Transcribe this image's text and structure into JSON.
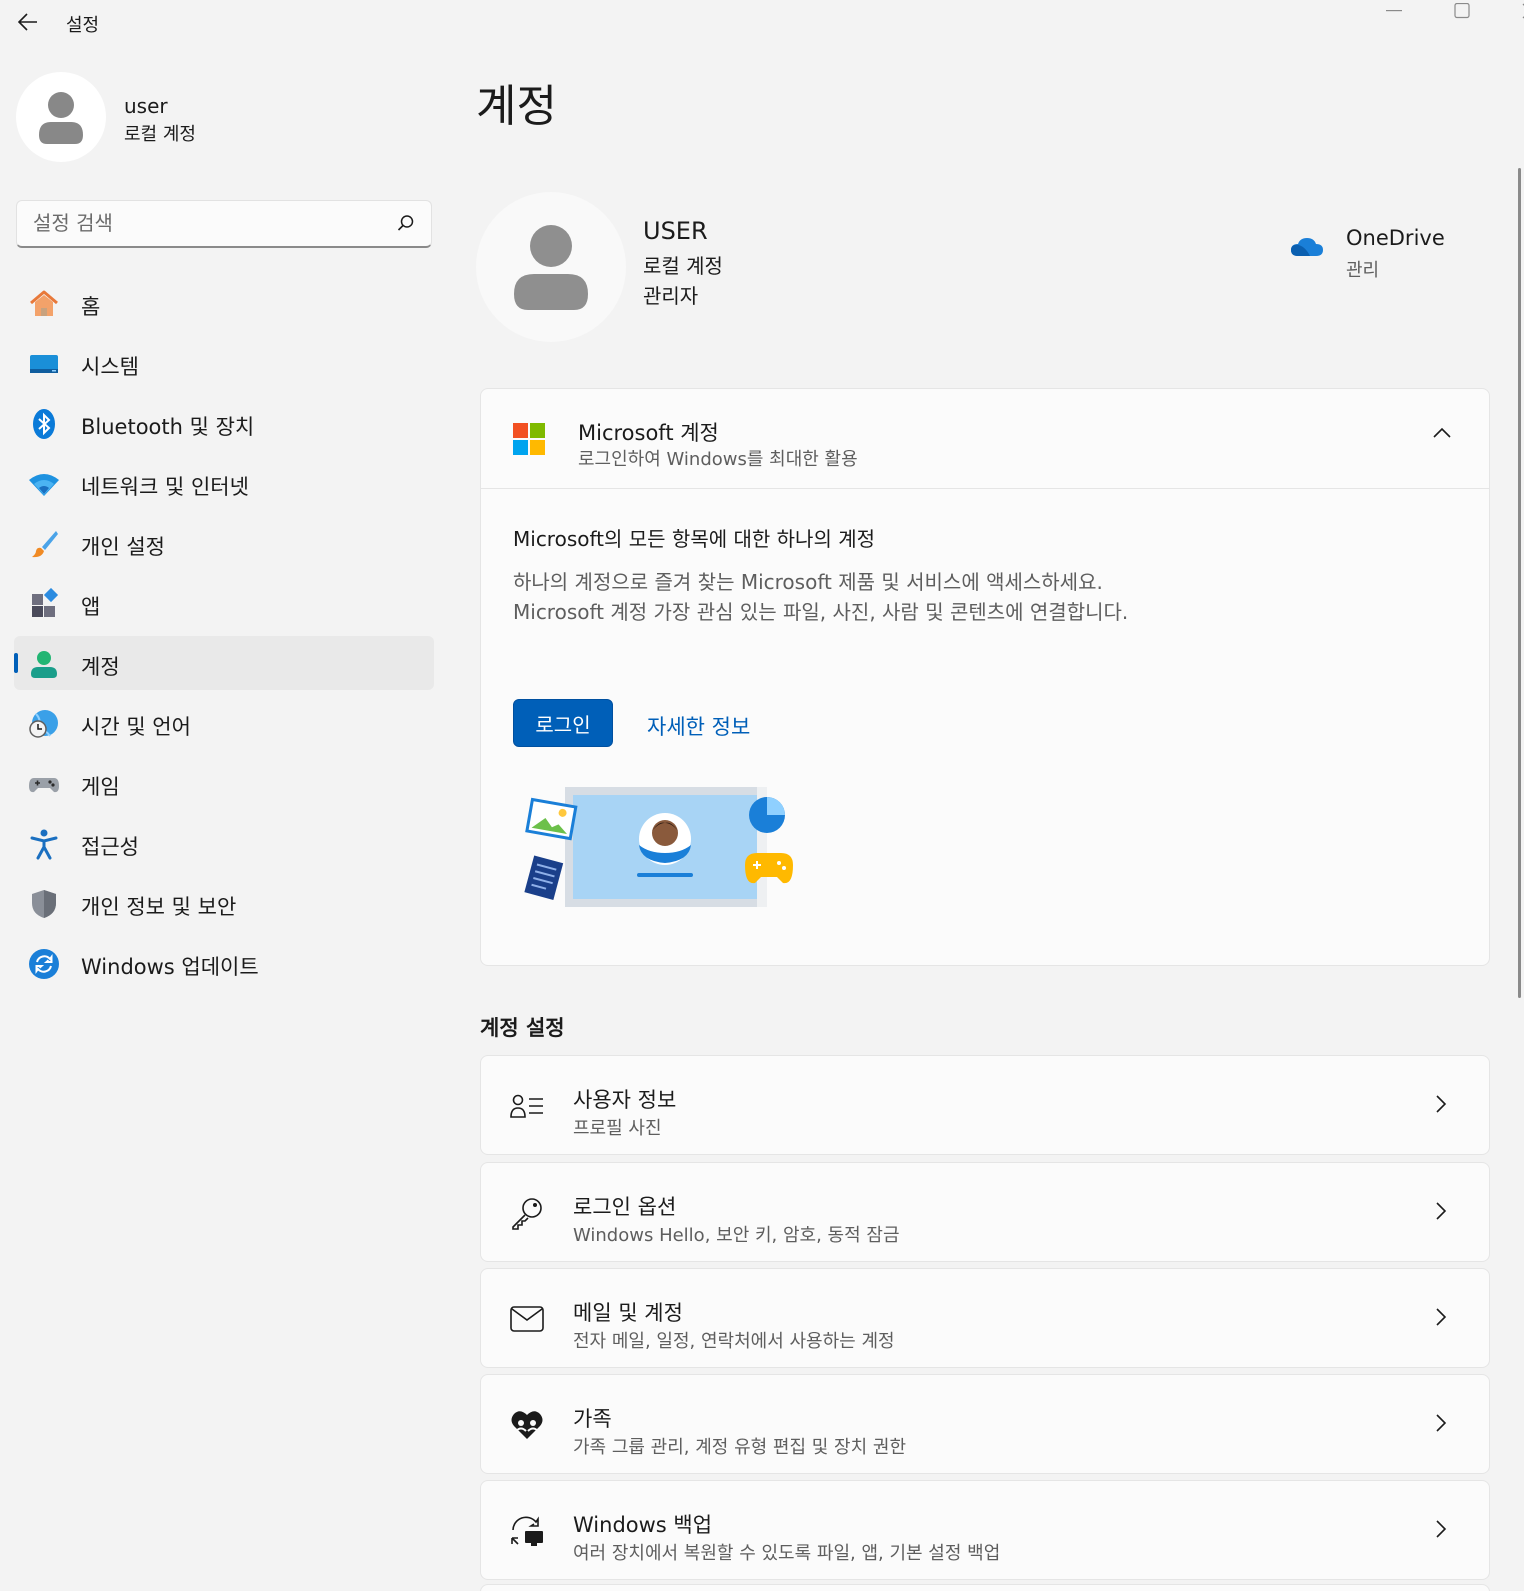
{
  "window": {
    "title": "설정"
  },
  "profile": {
    "name": "user",
    "account_type": "로컬 계정"
  },
  "search": {
    "placeholder": "설정 검색"
  },
  "nav": {
    "items": [
      {
        "label": "홈",
        "icon": "home-icon"
      },
      {
        "label": "시스템",
        "icon": "system-icon"
      },
      {
        "label": "Bluetooth 및 장치",
        "icon": "bluetooth-icon"
      },
      {
        "label": "네트워크 및 인터넷",
        "icon": "wifi-icon"
      },
      {
        "label": "개인 설정",
        "icon": "brush-icon"
      },
      {
        "label": "앱",
        "icon": "apps-icon"
      },
      {
        "label": "계정",
        "icon": "account-icon",
        "selected": true
      },
      {
        "label": "시간 및 언어",
        "icon": "time-language-icon"
      },
      {
        "label": "게임",
        "icon": "gamepad-icon"
      },
      {
        "label": "접근성",
        "icon": "accessibility-icon"
      },
      {
        "label": "개인 정보 및 보안",
        "icon": "shield-icon"
      },
      {
        "label": "Windows 업데이트",
        "icon": "update-icon"
      }
    ]
  },
  "main": {
    "title": "계정",
    "user": {
      "name": "USER",
      "type": "로컬 계정",
      "role": "관리자"
    },
    "onedrive": {
      "title": "OneDrive",
      "link": "관리"
    },
    "microsoft_account": {
      "title": "Microsoft 계정",
      "subtitle": "로그인하여 Windows를 최대한 활용",
      "body_title": "Microsoft의 모든 항목에 대한 하나의 계정",
      "body_text": "하나의 계정으로 즐겨 찾는 Microsoft 제품 및 서비스에 액세스하세요. Microsoft 계정 가장 관심 있는 파일, 사진, 사람 및 콘텐츠에 연결합니다.",
      "login_label": "로그인",
      "more_label": "자세한 정보"
    },
    "section_title": "계정 설정",
    "settings": [
      {
        "title": "사용자 정보",
        "subtitle": "프로필 사진",
        "icon": "user-info-icon"
      },
      {
        "title": "로그인 옵션",
        "subtitle": "Windows Hello, 보안 키, 암호, 동적 잠금",
        "icon": "key-icon"
      },
      {
        "title": "메일 및 계정",
        "subtitle": "전자 메일, 일정, 연락처에서 사용하는 계정",
        "icon": "mail-icon"
      },
      {
        "title": "가족",
        "subtitle": "가족 그룹 관리, 계정 유형 편집 및 장치 권한",
        "icon": "family-heart-icon"
      },
      {
        "title": "Windows 백업",
        "subtitle": "여러 장치에서 복원할 수 있도록 파일, 앱, 기본 설정 백업",
        "icon": "backup-icon"
      }
    ]
  },
  "colors": {
    "accent": "#005fb8",
    "background": "#f3f3f3",
    "card": "#fbfbfb"
  }
}
